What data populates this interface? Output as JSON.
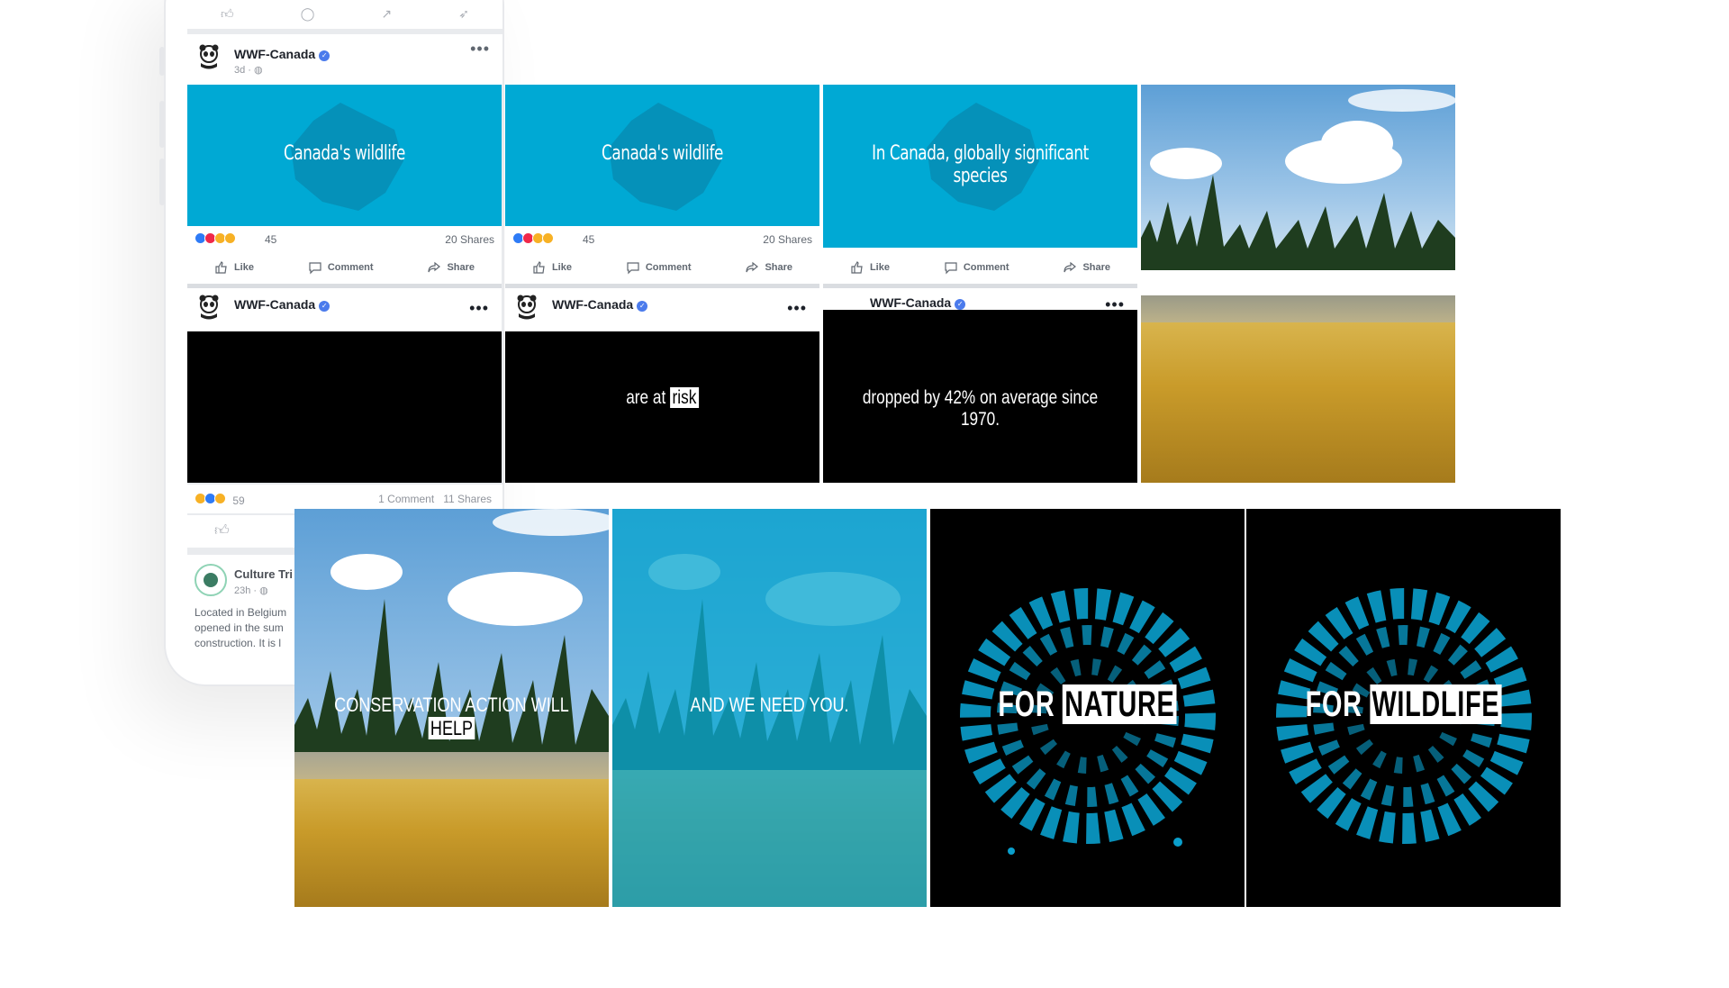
{
  "page_owner": "WWF-Canada",
  "logo_text": "WWF",
  "phone_feed": {
    "post1": {
      "name": "WWF-Canada",
      "meta": "3d · "
    },
    "reactions_bottom": {
      "count": "59",
      "comments": "1 Comment",
      "shares": "11 Shares"
    },
    "post2": {
      "name": "Culture Tri",
      "meta": "23h · ",
      "body_lines": [
        "Located in Belgium",
        "opened in the sum",
        "construction. It is l"
      ]
    }
  },
  "tiles": [
    {
      "title": "Canada's wildlife",
      "reaction_count": "45",
      "shares": "20 Shares",
      "bottom_text": "",
      "bottom_highlight": ""
    },
    {
      "title": "Canada's wildlife",
      "reaction_count": "45",
      "shares": "20 Shares",
      "bottom_text": "are at ",
      "bottom_highlight": "risk"
    },
    {
      "title": "In Canada, globally significant species",
      "reaction_count": "",
      "shares": "",
      "bottom_text": "dropped by 42% on average since 1970.",
      "bottom_highlight": ""
    }
  ],
  "actions": {
    "like": "Like",
    "comment": "Comment",
    "share": "Share"
  },
  "bottom_row": {
    "panel1": {
      "text": "CONSERVATION ACTION WILL ",
      "highlight": "HELP"
    },
    "panel2": {
      "text": "AND WE NEED YOU."
    },
    "panel3": {
      "text": "FOR ",
      "highlight": "NATURE"
    },
    "panel4": {
      "text": "FOR ",
      "highlight": "WILDLIFE"
    }
  },
  "colors": {
    "wwf_blue": "#00a9d4",
    "fb_verified": "#4b7bec",
    "black": "#000000"
  },
  "icons": [
    "panda-logo-icon",
    "verified-icon",
    "globe-icon",
    "more-dots-icon",
    "like-icon",
    "comment-icon",
    "share-icon",
    "reaction-emoji-icon"
  ]
}
